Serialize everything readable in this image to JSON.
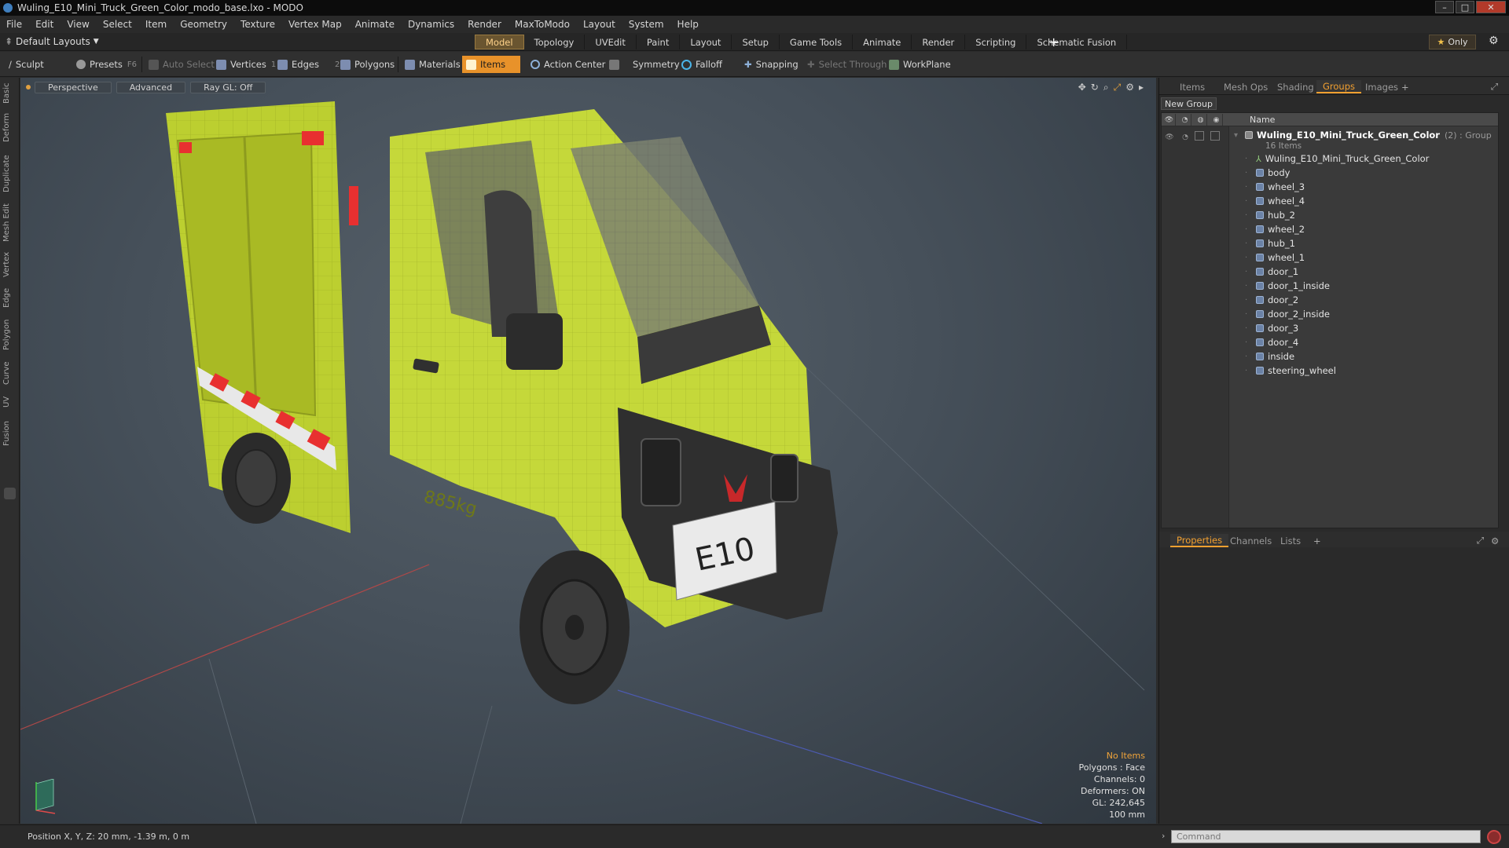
{
  "window": {
    "title": "Wuling_E10_Mini_Truck_Green_Color_modo_base.lxo - MODO",
    "controls": [
      "–",
      "□",
      "✕"
    ]
  },
  "menu": [
    "File",
    "Edit",
    "View",
    "Select",
    "Item",
    "Geometry",
    "Texture",
    "Vertex Map",
    "Animate",
    "Dynamics",
    "Render",
    "MaxToModo",
    "Layout",
    "System",
    "Help"
  ],
  "layout_selector": "Default Layouts",
  "mode_tabs": [
    "Model",
    "Topology",
    "UVEdit",
    "Paint",
    "Layout",
    "Setup",
    "Game Tools",
    "Animate",
    "Render",
    "Scripting",
    "Schematic Fusion"
  ],
  "active_mode_tab": "Model",
  "only_label": "Only",
  "toolbar": {
    "sculpt": "Sculpt",
    "presets": "Presets",
    "presets_key": "F6",
    "auto_select": "Auto Select",
    "vertices": "Vertices",
    "vertices_key": "1",
    "edges": "Edges",
    "edges_key": "2",
    "polygons": "Polygons",
    "materials": "Materials",
    "items": "Items",
    "action_center": "Action Center",
    "symmetry": "Symmetry",
    "falloff": "Falloff",
    "snapping": "Snapping",
    "select_through": "Select Through",
    "workplane": "WorkPlane"
  },
  "left_tabs": [
    "Basic",
    "Deform",
    "Duplicate",
    "Mesh Edit",
    "Vertex",
    "Edge",
    "Polygon",
    "Curve",
    "UV",
    "Fusion"
  ],
  "viewport": {
    "tabs": [
      "Perspective",
      "Advanced",
      "Ray GL: Off"
    ],
    "decal_weight": "885kg",
    "plate_text": "E10",
    "info": {
      "no_items": "No Items",
      "polygons": "Polygons : Face",
      "channels": "Channels: 0",
      "deformers": "Deformers: ON",
      "gl": "GL: 242,645",
      "scale": "100 mm"
    }
  },
  "right_panel": {
    "top_tabs": [
      "Items",
      "Mesh Ops",
      "Shading",
      "Groups",
      "Images"
    ],
    "active_top_tab": "Groups",
    "new_group": "New Group",
    "name_header": "Name",
    "group": {
      "name": "Wuling_E10_Mini_Truck_Green_Color",
      "suffix": "(2) : Group",
      "count": "16 Items"
    },
    "items": [
      "Wuling_E10_Mini_Truck_Green_Color",
      "body",
      "wheel_3",
      "wheel_4",
      "hub_2",
      "wheel_2",
      "hub_1",
      "wheel_1",
      "door_1",
      "door_1_inside",
      "door_2",
      "door_2_inside",
      "door_3",
      "door_4",
      "inside",
      "steering_wheel"
    ],
    "bottom_tabs": [
      "Properties",
      "Channels",
      "Lists"
    ],
    "active_bottom_tab": "Properties",
    "command_placeholder": "Command"
  },
  "status": {
    "position": "Position X, Y, Z:  20 mm, -1.39 m, 0 m"
  },
  "colors": {
    "accent": "#f2a030",
    "truck_body": "#c5d83a",
    "reflector_red": "#e83030"
  }
}
